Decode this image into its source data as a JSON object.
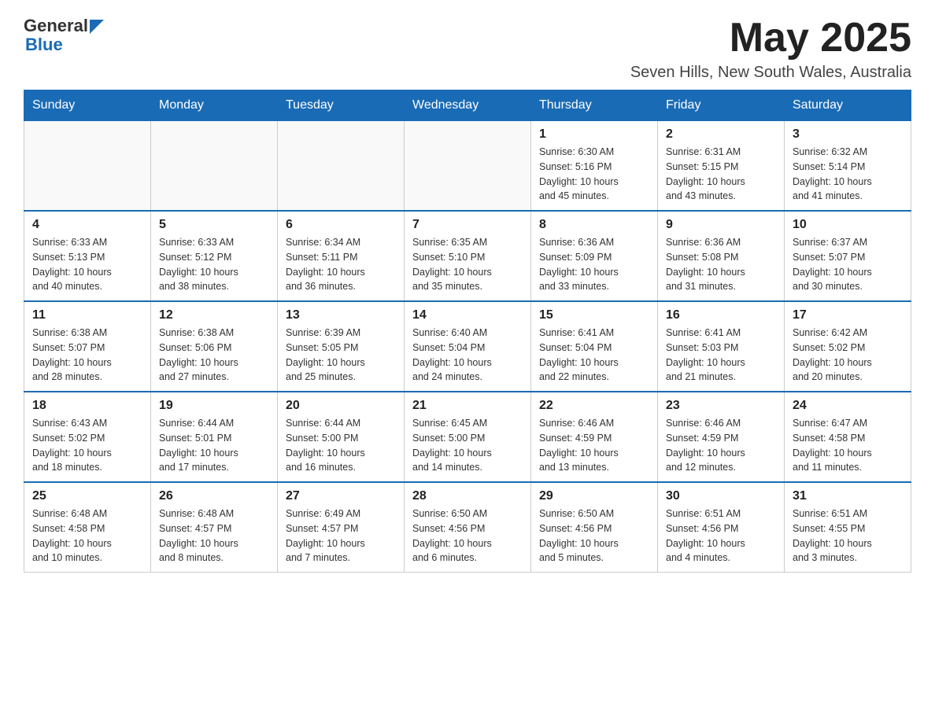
{
  "header": {
    "logo_general": "General",
    "logo_blue": "Blue",
    "month_title": "May 2025",
    "location": "Seven Hills, New South Wales, Australia"
  },
  "days_of_week": [
    "Sunday",
    "Monday",
    "Tuesday",
    "Wednesday",
    "Thursday",
    "Friday",
    "Saturday"
  ],
  "weeks": [
    [
      {
        "day": "",
        "info": ""
      },
      {
        "day": "",
        "info": ""
      },
      {
        "day": "",
        "info": ""
      },
      {
        "day": "",
        "info": ""
      },
      {
        "day": "1",
        "info": "Sunrise: 6:30 AM\nSunset: 5:16 PM\nDaylight: 10 hours\nand 45 minutes."
      },
      {
        "day": "2",
        "info": "Sunrise: 6:31 AM\nSunset: 5:15 PM\nDaylight: 10 hours\nand 43 minutes."
      },
      {
        "day": "3",
        "info": "Sunrise: 6:32 AM\nSunset: 5:14 PM\nDaylight: 10 hours\nand 41 minutes."
      }
    ],
    [
      {
        "day": "4",
        "info": "Sunrise: 6:33 AM\nSunset: 5:13 PM\nDaylight: 10 hours\nand 40 minutes."
      },
      {
        "day": "5",
        "info": "Sunrise: 6:33 AM\nSunset: 5:12 PM\nDaylight: 10 hours\nand 38 minutes."
      },
      {
        "day": "6",
        "info": "Sunrise: 6:34 AM\nSunset: 5:11 PM\nDaylight: 10 hours\nand 36 minutes."
      },
      {
        "day": "7",
        "info": "Sunrise: 6:35 AM\nSunset: 5:10 PM\nDaylight: 10 hours\nand 35 minutes."
      },
      {
        "day": "8",
        "info": "Sunrise: 6:36 AM\nSunset: 5:09 PM\nDaylight: 10 hours\nand 33 minutes."
      },
      {
        "day": "9",
        "info": "Sunrise: 6:36 AM\nSunset: 5:08 PM\nDaylight: 10 hours\nand 31 minutes."
      },
      {
        "day": "10",
        "info": "Sunrise: 6:37 AM\nSunset: 5:07 PM\nDaylight: 10 hours\nand 30 minutes."
      }
    ],
    [
      {
        "day": "11",
        "info": "Sunrise: 6:38 AM\nSunset: 5:07 PM\nDaylight: 10 hours\nand 28 minutes."
      },
      {
        "day": "12",
        "info": "Sunrise: 6:38 AM\nSunset: 5:06 PM\nDaylight: 10 hours\nand 27 minutes."
      },
      {
        "day": "13",
        "info": "Sunrise: 6:39 AM\nSunset: 5:05 PM\nDaylight: 10 hours\nand 25 minutes."
      },
      {
        "day": "14",
        "info": "Sunrise: 6:40 AM\nSunset: 5:04 PM\nDaylight: 10 hours\nand 24 minutes."
      },
      {
        "day": "15",
        "info": "Sunrise: 6:41 AM\nSunset: 5:04 PM\nDaylight: 10 hours\nand 22 minutes."
      },
      {
        "day": "16",
        "info": "Sunrise: 6:41 AM\nSunset: 5:03 PM\nDaylight: 10 hours\nand 21 minutes."
      },
      {
        "day": "17",
        "info": "Sunrise: 6:42 AM\nSunset: 5:02 PM\nDaylight: 10 hours\nand 20 minutes."
      }
    ],
    [
      {
        "day": "18",
        "info": "Sunrise: 6:43 AM\nSunset: 5:02 PM\nDaylight: 10 hours\nand 18 minutes."
      },
      {
        "day": "19",
        "info": "Sunrise: 6:44 AM\nSunset: 5:01 PM\nDaylight: 10 hours\nand 17 minutes."
      },
      {
        "day": "20",
        "info": "Sunrise: 6:44 AM\nSunset: 5:00 PM\nDaylight: 10 hours\nand 16 minutes."
      },
      {
        "day": "21",
        "info": "Sunrise: 6:45 AM\nSunset: 5:00 PM\nDaylight: 10 hours\nand 14 minutes."
      },
      {
        "day": "22",
        "info": "Sunrise: 6:46 AM\nSunset: 4:59 PM\nDaylight: 10 hours\nand 13 minutes."
      },
      {
        "day": "23",
        "info": "Sunrise: 6:46 AM\nSunset: 4:59 PM\nDaylight: 10 hours\nand 12 minutes."
      },
      {
        "day": "24",
        "info": "Sunrise: 6:47 AM\nSunset: 4:58 PM\nDaylight: 10 hours\nand 11 minutes."
      }
    ],
    [
      {
        "day": "25",
        "info": "Sunrise: 6:48 AM\nSunset: 4:58 PM\nDaylight: 10 hours\nand 10 minutes."
      },
      {
        "day": "26",
        "info": "Sunrise: 6:48 AM\nSunset: 4:57 PM\nDaylight: 10 hours\nand 8 minutes."
      },
      {
        "day": "27",
        "info": "Sunrise: 6:49 AM\nSunset: 4:57 PM\nDaylight: 10 hours\nand 7 minutes."
      },
      {
        "day": "28",
        "info": "Sunrise: 6:50 AM\nSunset: 4:56 PM\nDaylight: 10 hours\nand 6 minutes."
      },
      {
        "day": "29",
        "info": "Sunrise: 6:50 AM\nSunset: 4:56 PM\nDaylight: 10 hours\nand 5 minutes."
      },
      {
        "day": "30",
        "info": "Sunrise: 6:51 AM\nSunset: 4:56 PM\nDaylight: 10 hours\nand 4 minutes."
      },
      {
        "day": "31",
        "info": "Sunrise: 6:51 AM\nSunset: 4:55 PM\nDaylight: 10 hours\nand 3 minutes."
      }
    ]
  ]
}
